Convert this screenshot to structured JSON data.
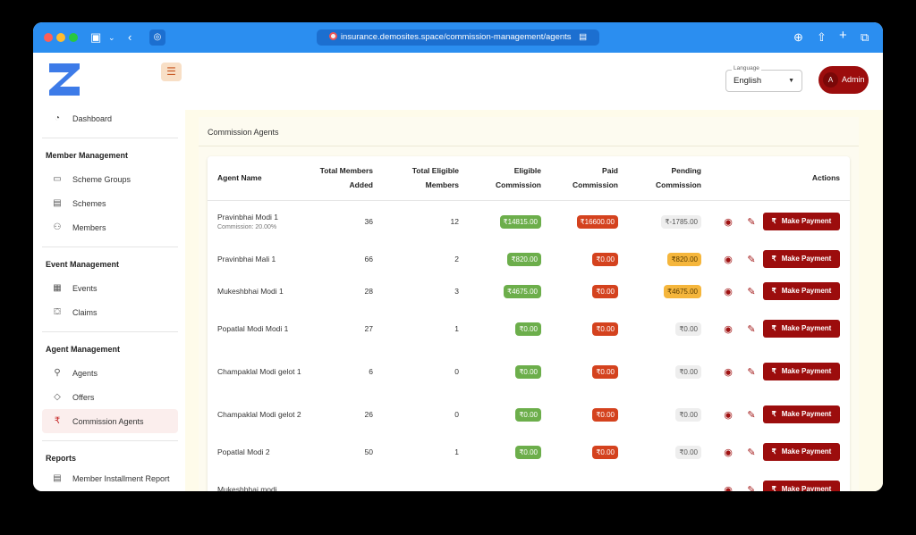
{
  "browser": {
    "url": "insurance.demosites.space/commission-management/agents"
  },
  "header": {
    "language_label": "Language",
    "language_value": "English",
    "admin_initial": "A",
    "admin_name": "Admin"
  },
  "sidebar": {
    "dashboard": "Dashboard",
    "sections": [
      {
        "title": "Member Management",
        "items": [
          "Scheme Groups",
          "Schemes",
          "Members"
        ]
      },
      {
        "title": "Event Management",
        "items": [
          "Events",
          "Claims"
        ]
      },
      {
        "title": "Agent Management",
        "items": [
          "Agents",
          "Offers",
          "Commission Agents"
        ]
      },
      {
        "title": "Reports",
        "items": [
          "Member Installment Report"
        ]
      }
    ]
  },
  "page": {
    "title": "Commission Agents"
  },
  "table": {
    "headers": {
      "agent_name": "Agent Name",
      "total_members_1": "Total Members",
      "total_members_2": "Added",
      "total_eligible_1": "Total Eligible",
      "total_eligible_2": "Members",
      "eligible_comm_1": "Eligible",
      "eligible_comm_2": "Commission",
      "paid_comm_1": "Paid",
      "paid_comm_2": "Commission",
      "pending_comm_1": "Pending",
      "pending_comm_2": "Commission",
      "actions": "Actions"
    },
    "pay_label": "Make Payment",
    "rows": [
      {
        "name": "Pravinbhai Modi 1",
        "sub": "Commission: 20.00%",
        "total": "36",
        "eligible": "12",
        "eligible_comm": "₹14815.00",
        "paid_comm": "₹16600.00",
        "pending_comm": "₹-1785.00",
        "pending_style": "grey"
      },
      {
        "name": "Pravinbhai Mali 1",
        "sub": "",
        "total": "66",
        "eligible": "2",
        "eligible_comm": "₹820.00",
        "paid_comm": "₹0.00",
        "pending_comm": "₹820.00",
        "pending_style": "yellow"
      },
      {
        "name": "Mukeshbhai Modi 1",
        "sub": "",
        "total": "28",
        "eligible": "3",
        "eligible_comm": "₹4675.00",
        "paid_comm": "₹0.00",
        "pending_comm": "₹4675.00",
        "pending_style": "yellow"
      },
      {
        "name": "Popatlal Modi Modi 1",
        "sub": "",
        "total": "27",
        "eligible": "1",
        "eligible_comm": "₹0.00",
        "paid_comm": "₹0.00",
        "pending_comm": "₹0.00",
        "pending_style": "grey"
      },
      {
        "name": "Champaklal Modi gelot 1",
        "sub": "",
        "total": "6",
        "eligible": "0",
        "eligible_comm": "₹0.00",
        "paid_comm": "₹0.00",
        "pending_comm": "₹0.00",
        "pending_style": "grey"
      },
      {
        "name": "Champaklal Modi gelot 2",
        "sub": "",
        "total": "26",
        "eligible": "0",
        "eligible_comm": "₹0.00",
        "paid_comm": "₹0.00",
        "pending_comm": "₹0.00",
        "pending_style": "grey"
      },
      {
        "name": "Popatlal Modi 2",
        "sub": "",
        "total": "50",
        "eligible": "1",
        "eligible_comm": "₹0.00",
        "paid_comm": "₹0.00",
        "pending_comm": "₹0.00",
        "pending_style": "grey"
      },
      {
        "name": "Mukeshbhai modi",
        "sub": "",
        "total": "",
        "eligible": "",
        "eligible_comm": "",
        "paid_comm": "",
        "pending_comm": "",
        "pending_style": "yellow"
      }
    ]
  }
}
